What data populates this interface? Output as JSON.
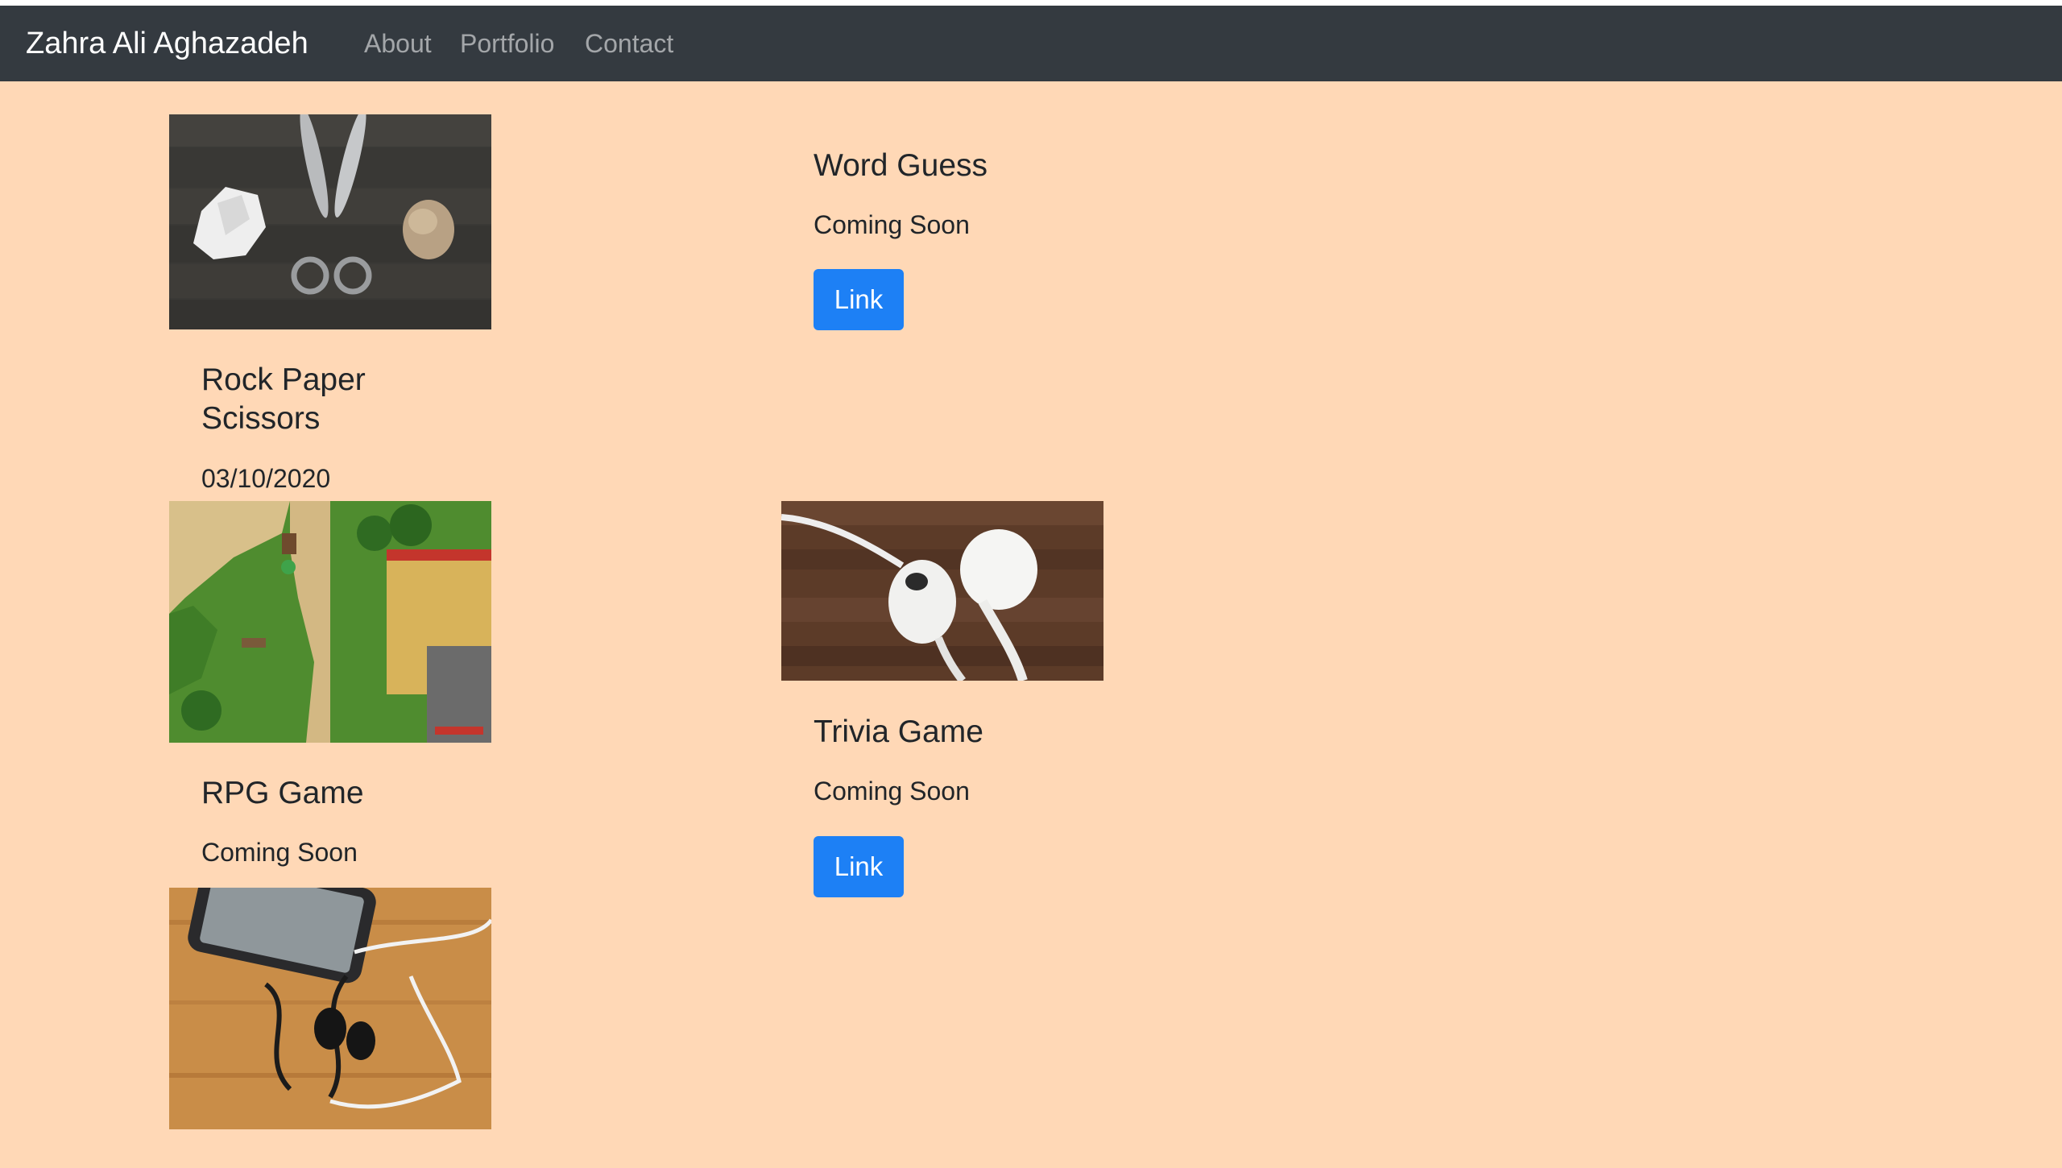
{
  "navbar": {
    "brand": "Zahra Ali Aghazadeh",
    "links": [
      "About",
      "Portfolio",
      "Contact"
    ]
  },
  "projects": [
    {
      "title": "Rock Paper Scissors",
      "text": "03/10/2020",
      "image": "rock-paper-scissors-photo"
    },
    {
      "title": "Word Guess",
      "text": "Coming Soon",
      "button": "Link"
    },
    {
      "title": "RPG Game",
      "text": "Coming Soon",
      "image": "rpg-map-screenshot"
    },
    {
      "title": "Trivia Game",
      "text": "Coming Soon",
      "button": "Link",
      "image": "earbuds-photo"
    },
    {
      "image": "phone-headphones-photo"
    }
  ],
  "colors": {
    "page_bg": "#ffd8b6",
    "navbar_bg": "#343a40",
    "button_bg": "#1d80f5"
  }
}
